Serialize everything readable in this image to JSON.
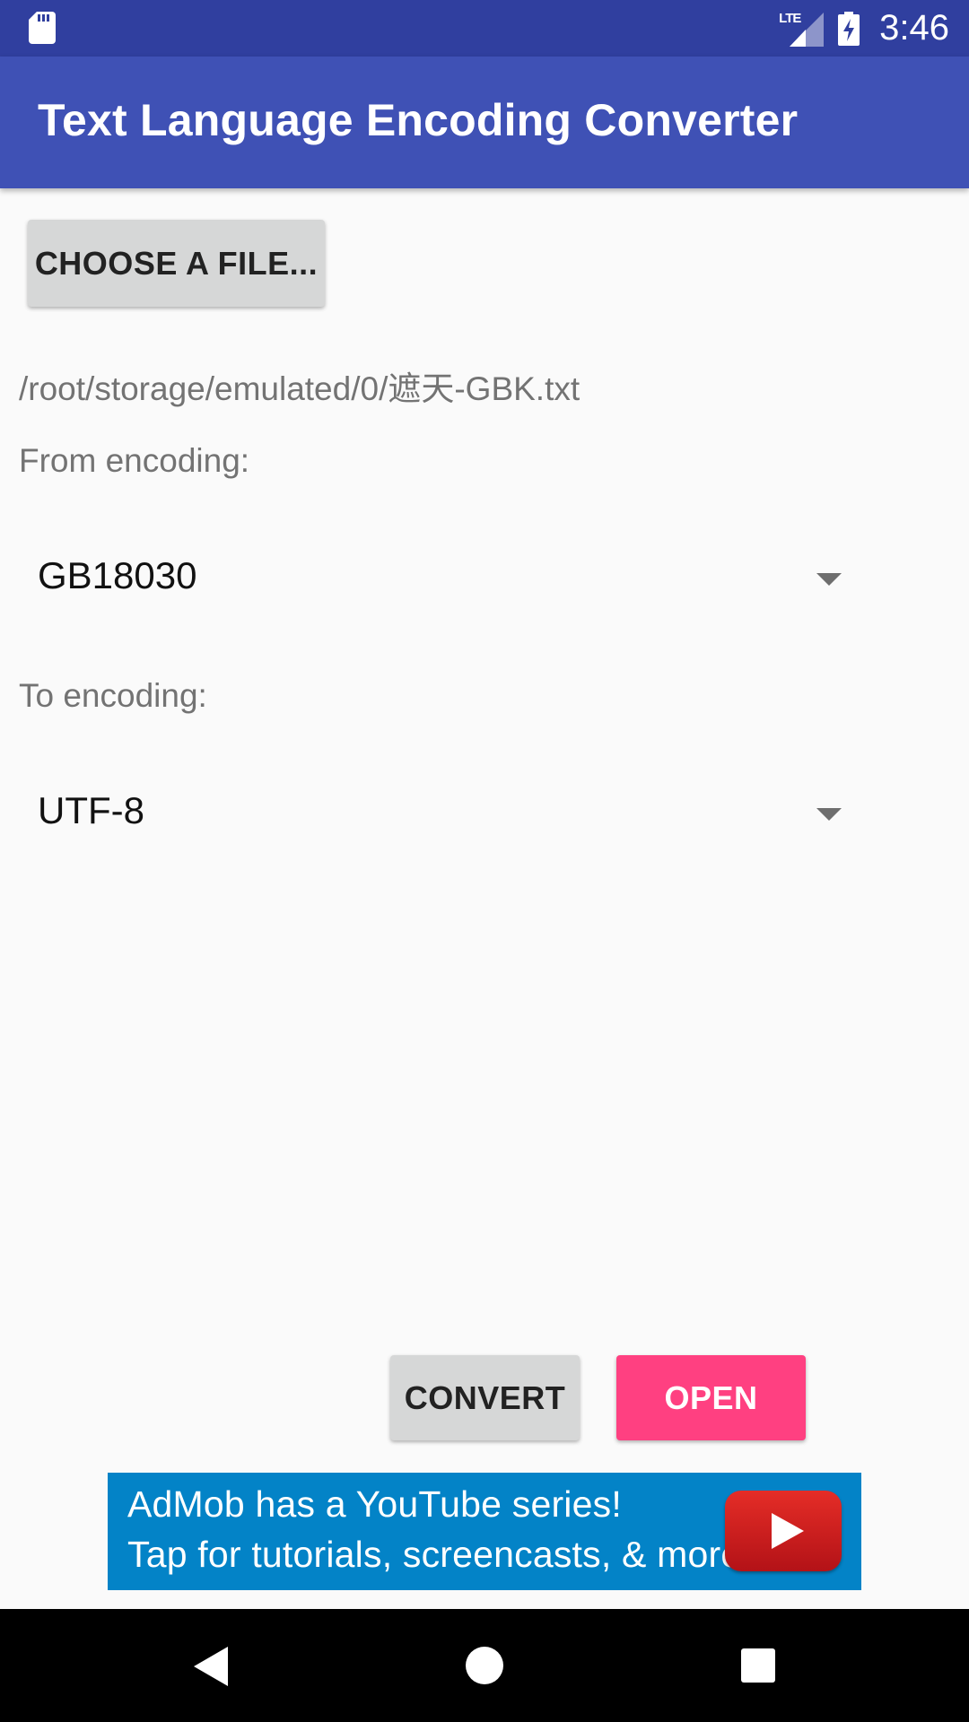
{
  "status_bar": {
    "time": "3:46",
    "network": "LTE",
    "icons": [
      "sd-card-icon",
      "signal-icon",
      "battery-charging-icon"
    ]
  },
  "app_bar": {
    "title": "Text Language Encoding Converter"
  },
  "file_picker": {
    "button_label": "CHOOSE A FILE...",
    "selected_path": "/root/storage/emulated/0/遮天-GBK.txt"
  },
  "from_encoding": {
    "label": "From encoding:",
    "selected": "GB18030"
  },
  "to_encoding": {
    "label": "To encoding:",
    "selected": "UTF-8"
  },
  "actions": {
    "convert_label": "CONVERT",
    "open_label": "OPEN"
  },
  "ad": {
    "line1": "AdMob has a YouTube series!",
    "line2": "Tap for tutorials, screencasts, & more.",
    "icon": "youtube-play-icon"
  },
  "nav_bar": {
    "icons": [
      "back-icon",
      "home-icon",
      "recents-icon"
    ]
  },
  "colors": {
    "status_bar": "#303f9f",
    "app_bar": "#3f51b5",
    "accent": "#ff4081",
    "ad_background": "#0383c7"
  }
}
